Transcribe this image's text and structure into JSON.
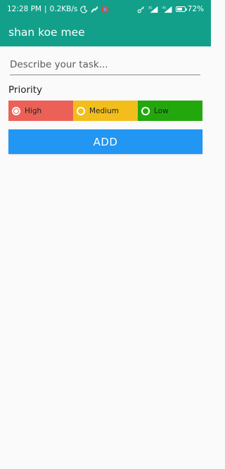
{
  "status_bar": {
    "time": "12:28 PM",
    "data_speed": "0.2KB/s",
    "left_icons": [
      "moon-icon",
      "network-off-icon",
      "notification-icon"
    ],
    "right_icons": [
      "key-icon",
      "signal-3g-icon",
      "signal-4g-icon",
      "battery-icon"
    ],
    "net_label_1": "3G",
    "net_label_2": "4G",
    "battery_percent": "72",
    "battery_suffix": "%",
    "battery_level": 0.72
  },
  "app_bar": {
    "title": "shan koe mee"
  },
  "task_input": {
    "value": "",
    "placeholder": "Describe your task..."
  },
  "priority": {
    "label": "Priority",
    "options": [
      {
        "label": "High",
        "selected": true,
        "color": "#eb6157"
      },
      {
        "label": "Medium",
        "selected": false,
        "color": "#f2be1b"
      },
      {
        "label": "Low",
        "selected": false,
        "color": "#22a80c"
      }
    ]
  },
  "add_button": {
    "label": "ADD"
  },
  "colors": {
    "primary": "#12a08a",
    "accent": "#2196f3",
    "background": "#fafafa"
  }
}
